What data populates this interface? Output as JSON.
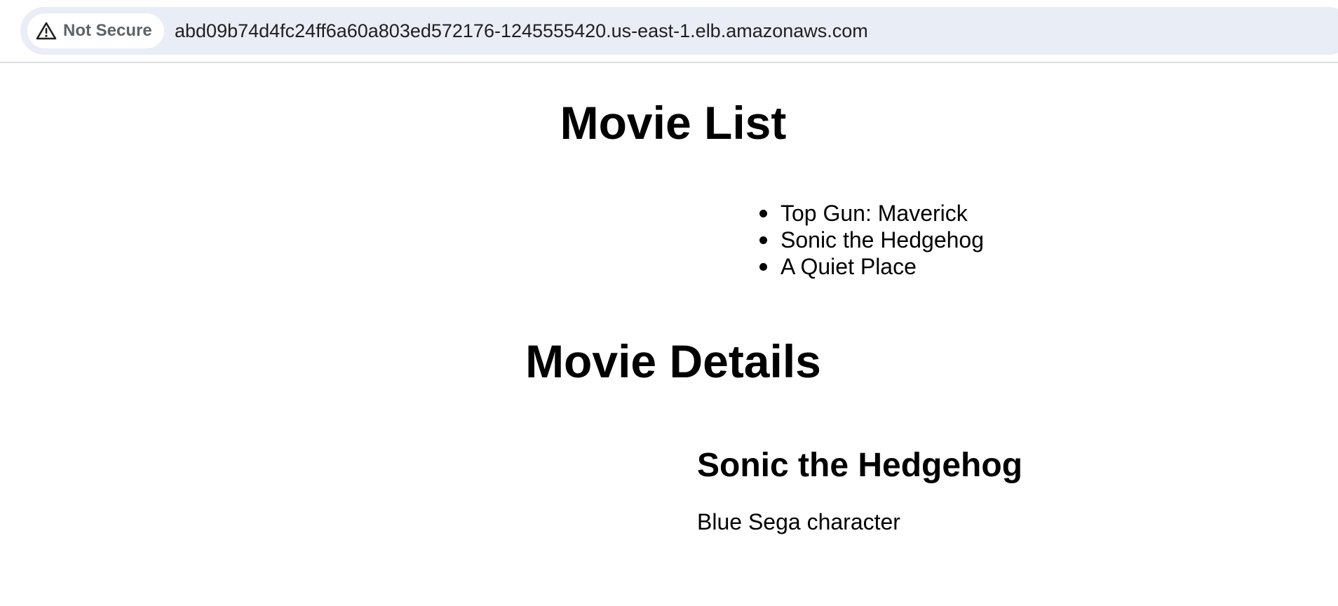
{
  "browser": {
    "security_label": "Not Secure",
    "url": "abd09b74d4fc24ff6a60a803ed572176-1245555420.us-east-1.elb.amazonaws.com",
    "security_icon": "warning-triangle-icon"
  },
  "page": {
    "list_title": "Movie List",
    "movies": [
      {
        "title": "Top Gun: Maverick"
      },
      {
        "title": "Sonic the Hedgehog"
      },
      {
        "title": "A Quiet Place"
      }
    ],
    "details_title": "Movie Details",
    "selected_movie": {
      "title": "Sonic the Hedgehog",
      "description": "Blue Sega character"
    }
  },
  "colors": {
    "omnibox_bg": "#e9edf5",
    "security_text": "#5f6368",
    "page_text": "#000000"
  }
}
